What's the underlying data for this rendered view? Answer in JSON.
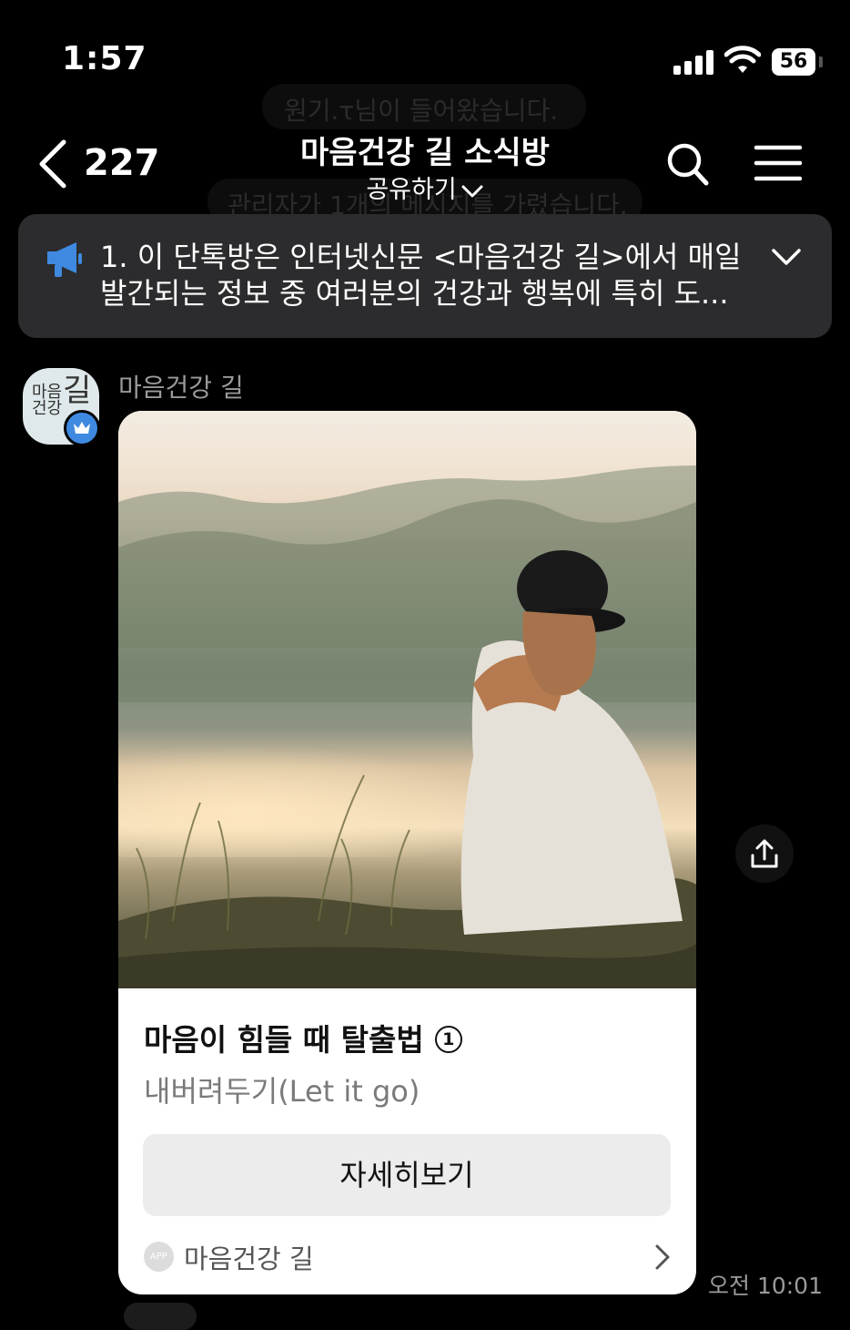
{
  "status_bar": {
    "time": "1:57",
    "battery": "56"
  },
  "background_messages": [
    "원기.τ님이 들어왔습니다.",
    "관리자가 1개의 메시지를 가렸습니다."
  ],
  "header": {
    "back_count": "227",
    "title": "마음건강 길 소식방",
    "share_label": "공유하기"
  },
  "notice": {
    "line1": "1. 이 단톡방은 인터넷신문 <마음건강 길>에서 매일",
    "line2": "발간되는 정보 중 여러분의 건강과 행복에 특히 도..."
  },
  "message": {
    "sender_name": "마음건강 길",
    "avatar_logo": {
      "small": "마음\n건강",
      "big": "길"
    },
    "card": {
      "title": "마음이 힘들 때 탈출법",
      "title_number": "1",
      "subtitle": "내버려두기(Let it go)",
      "button_label": "자세히보기",
      "app_badge": "APP",
      "app_name": "마음건강 길"
    },
    "time": "오전 10:01"
  },
  "colors": {
    "background": "#000000",
    "notice_bg": "#2c2c2e",
    "megaphone": "#3f8ae0",
    "card_bg": "#ffffff",
    "button_bg": "#ececec"
  },
  "icons": [
    "back-chevron-icon",
    "chevron-down-icon",
    "search-icon",
    "menu-icon",
    "megaphone-icon",
    "crown-icon",
    "share-icon",
    "chevron-right-icon"
  ]
}
